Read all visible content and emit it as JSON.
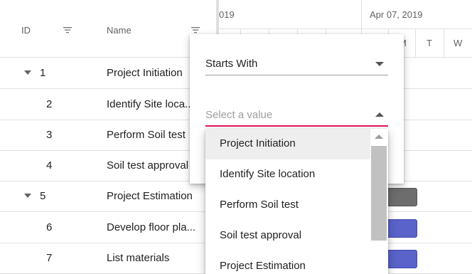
{
  "grid": {
    "headers": {
      "id": "ID",
      "name": "Name"
    },
    "rows": [
      {
        "id": "1",
        "name": "Project Initiation",
        "expandable": true
      },
      {
        "id": "2",
        "name": "Identify Site loca...",
        "expandable": false
      },
      {
        "id": "3",
        "name": "Perform Soil test",
        "expandable": false
      },
      {
        "id": "4",
        "name": "Soil test approval",
        "expandable": false
      },
      {
        "id": "5",
        "name": "Project Estimation",
        "expandable": true
      },
      {
        "id": "6",
        "name": "Develop floor pla...",
        "expandable": false
      },
      {
        "id": "7",
        "name": "List materials",
        "expandable": false
      }
    ]
  },
  "timeline": {
    "top_left": "019",
    "top_week": "Apr 07, 2019",
    "days": [
      "M",
      "T",
      "W"
    ]
  },
  "filter_popup": {
    "operator": "Starts With",
    "value_placeholder": "Select a value",
    "options": [
      "Project Initiation",
      "Identify Site location",
      "Perform Soil test",
      "Soil test approval",
      "Project Estimation"
    ],
    "highlighted_option": "Project Initiation"
  },
  "colors": {
    "accent": "#e3165b",
    "taskbar_parent": "#6d6d6d",
    "taskbar_child": "#5a63c9",
    "header_text": "#616161"
  }
}
